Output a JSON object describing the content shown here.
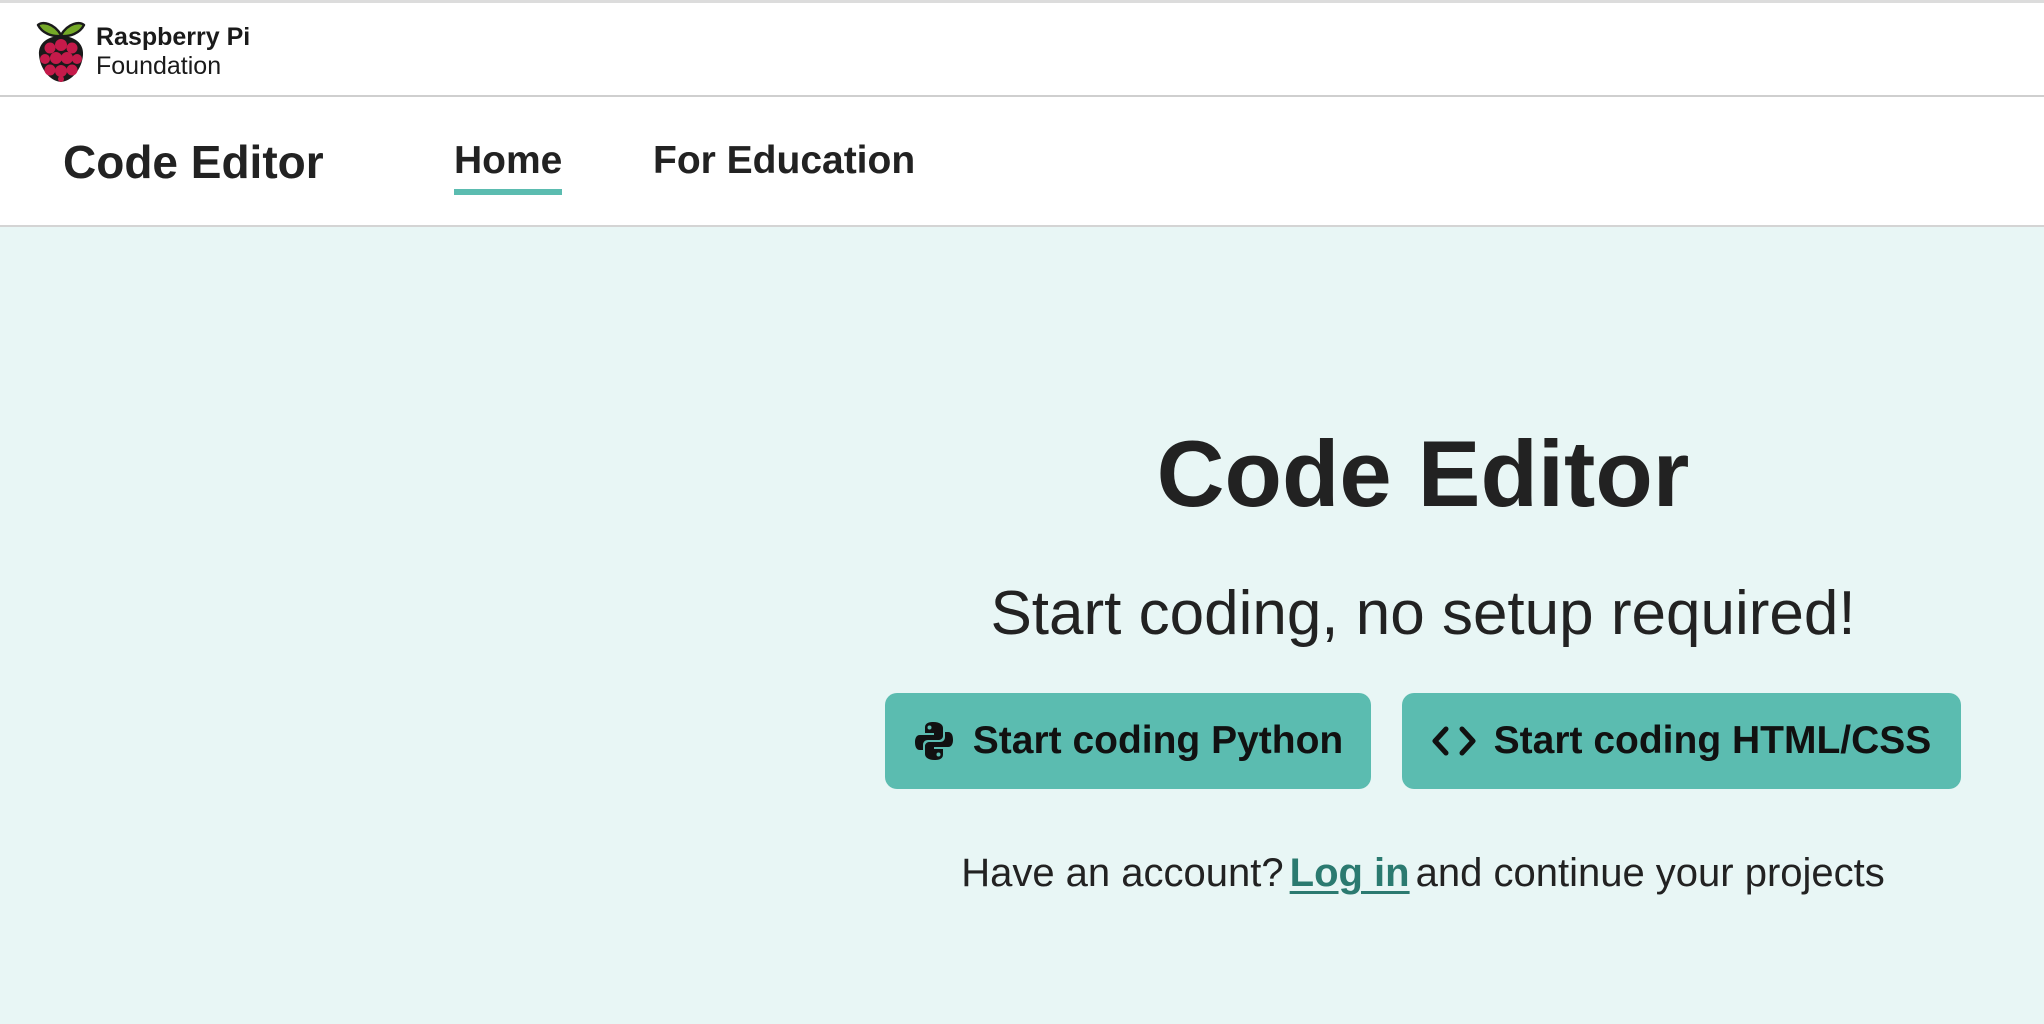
{
  "brand": {
    "line1": "Raspberry Pi",
    "line2": "Foundation",
    "logo_icon": "raspberry-logo-icon",
    "logo_colors": {
      "berry": "#c51a4a",
      "leaf": "#75a928",
      "outline": "#1a1a1a"
    }
  },
  "nav": {
    "title": "Code Editor",
    "links": [
      {
        "label": "Home",
        "active": true
      },
      {
        "label": "For Education",
        "active": false
      }
    ]
  },
  "hero": {
    "title": "Code Editor",
    "subtitle": "Start coding, no setup required!",
    "buttons": [
      {
        "label": "Start coding Python",
        "icon": "python-icon"
      },
      {
        "label": "Start coding HTML/CSS",
        "icon": "code-brackets-icon"
      }
    ],
    "login_prefix": "Have an account?",
    "login_link": "Log in",
    "login_suffix": "and continue your projects"
  },
  "colors": {
    "accent": "#5bbcb0",
    "hero_background": "#e8f6f5",
    "link": "#2b7a70",
    "text": "#222222"
  }
}
